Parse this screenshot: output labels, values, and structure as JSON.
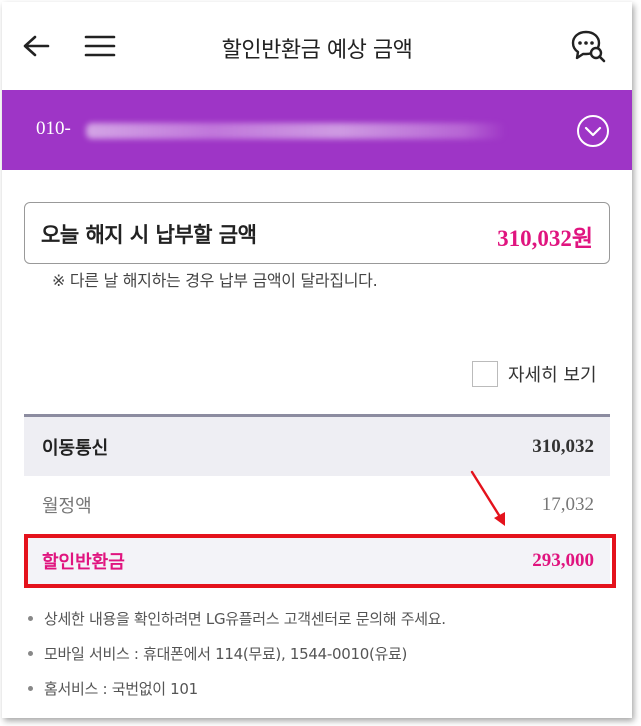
{
  "header": {
    "title": "할인반환금 예상 금액",
    "back_icon": "back-arrow-icon",
    "menu_icon": "hamburger-menu-icon",
    "chat_icon": "chat-search-icon"
  },
  "line_bar": {
    "phone_prefix": "010-",
    "expand_icon": "chevron-down-circle-icon",
    "color": "#9e35c6"
  },
  "summary": {
    "label": "오늘 해지 시 납부할 금액",
    "amount": "310,032원",
    "note": "※ 다른 날 해지하는 경우 납부 금액이 달라집니다."
  },
  "detail_toggle": {
    "label": "자세히 보기",
    "checked": false
  },
  "breakdown": [
    {
      "label": "이동통신",
      "value": "310,032"
    },
    {
      "label": "월정액",
      "value": "17,032"
    },
    {
      "label": "할인반환금",
      "value": "293,000"
    }
  ],
  "info_notes": [
    "상세한 내용을 확인하려면 LG유플러스 고객센터로 문의해 주세요.",
    "모바일 서비스 : 휴대폰에서 114(무료), 1544-0010(유료)",
    "홈서비스 : 국번없이 101"
  ],
  "colors": {
    "accent": "#e0147f",
    "highlight_border": "#e4121c"
  }
}
